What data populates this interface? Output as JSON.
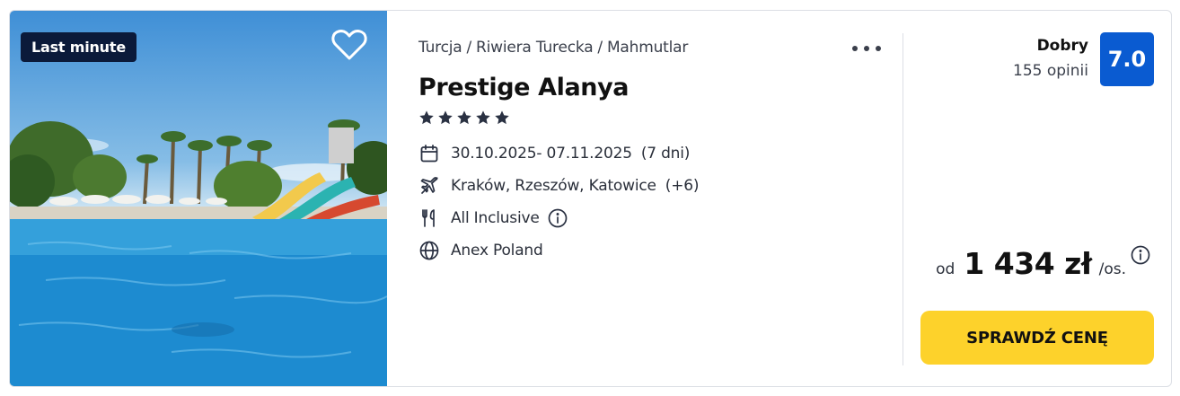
{
  "badge": {
    "label": "Last minute"
  },
  "location": {
    "country": "Turcja",
    "region": "Riwiera Turecka",
    "city": "Mahmutlar",
    "separator": "/"
  },
  "hotel": {
    "name": "Prestige Alanya",
    "stars": 5
  },
  "details": {
    "dates": "30.10.2025- 07.11.2025",
    "duration": "(7 dni)",
    "departures": "Kraków, Rzeszów, Katowice",
    "departures_more": "(+6)",
    "board": "All Inclusive",
    "operator": "Anex Poland"
  },
  "rating": {
    "word": "Dobry",
    "count": "155 opinii",
    "score": "7.0"
  },
  "price": {
    "prefix": "od",
    "amount": "1 434 zł",
    "unit": "/os."
  },
  "cta": {
    "label": "SPRAWDŹ CENĘ"
  },
  "colors": {
    "badge_bg": "#0b1a3a",
    "rating_bg": "#0a5bd1",
    "cta_bg": "#fdd22b"
  },
  "icons": {
    "favorite": "heart-icon",
    "more": "more-icon",
    "star": "star-icon",
    "dates": "calendar-icon",
    "departures": "plane-icon",
    "board": "utensils-icon",
    "board_info": "info-icon",
    "operator": "globe-icon",
    "price_info": "info-icon"
  }
}
